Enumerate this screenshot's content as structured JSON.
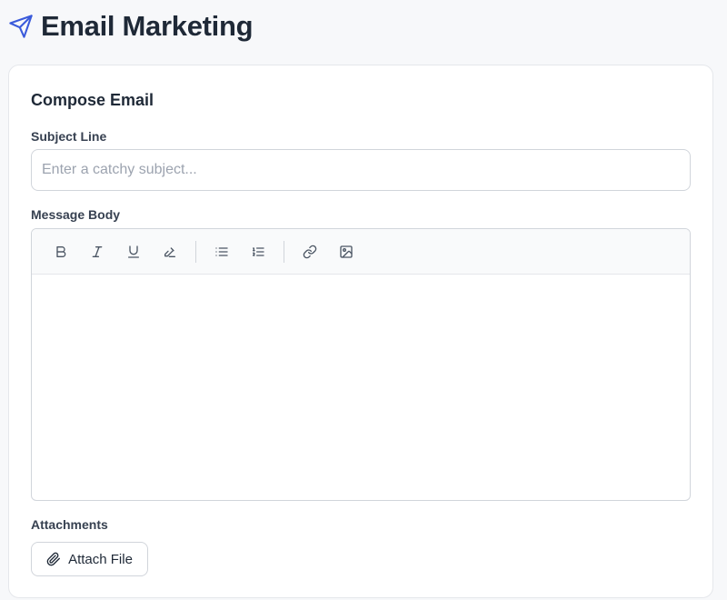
{
  "header": {
    "icon": "send-icon",
    "title": "Email Marketing",
    "accent_color": "#3b5bdb"
  },
  "compose": {
    "title": "Compose Email",
    "subject": {
      "label": "Subject Line",
      "placeholder": "Enter a catchy subject...",
      "value": ""
    },
    "message": {
      "label": "Message Body",
      "toolbar": [
        "bold-icon",
        "italic-icon",
        "underline-icon",
        "strikethrough-icon",
        "bullet-list-icon",
        "numbered-list-icon",
        "link-icon",
        "image-icon"
      ],
      "value": ""
    },
    "attachments": {
      "label": "Attachments",
      "button_label": "Attach File",
      "button_icon": "paperclip-icon"
    }
  }
}
